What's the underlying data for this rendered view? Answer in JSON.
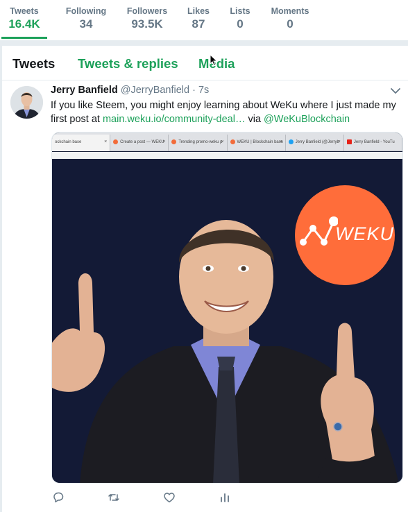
{
  "stats": [
    {
      "label": "Tweets",
      "value": "16.4K",
      "active": true
    },
    {
      "label": "Following",
      "value": "34"
    },
    {
      "label": "Followers",
      "value": "93.5K"
    },
    {
      "label": "Likes",
      "value": "87"
    },
    {
      "label": "Lists",
      "value": "0"
    },
    {
      "label": "Moments",
      "value": "0"
    }
  ],
  "tabs": [
    "Tweets",
    "Tweets & replies",
    "Media"
  ],
  "tweet": {
    "name": "Jerry Banfield",
    "handle": "@JerryBanfield",
    "time": "· 7s",
    "text_before": "If you like Steem, you might enjoy learning about WeKu where I just made my first post at ",
    "link": "main.weku.io/community-deal…",
    "via": " via ",
    "mention": "@WeKuBlockchain"
  },
  "media": {
    "browser_tabs": [
      "ockchain base",
      "Create a post — WEKU",
      "Trending promo-weku p",
      "WEKU | Blockchain base",
      "Jerry Banfield (@Jerryb",
      "Jerry Banfield - YouTu"
    ],
    "logo_text": "WEKU"
  },
  "colors": {
    "accent": "#1da15a",
    "weku_orange": "#ff6d3a"
  }
}
